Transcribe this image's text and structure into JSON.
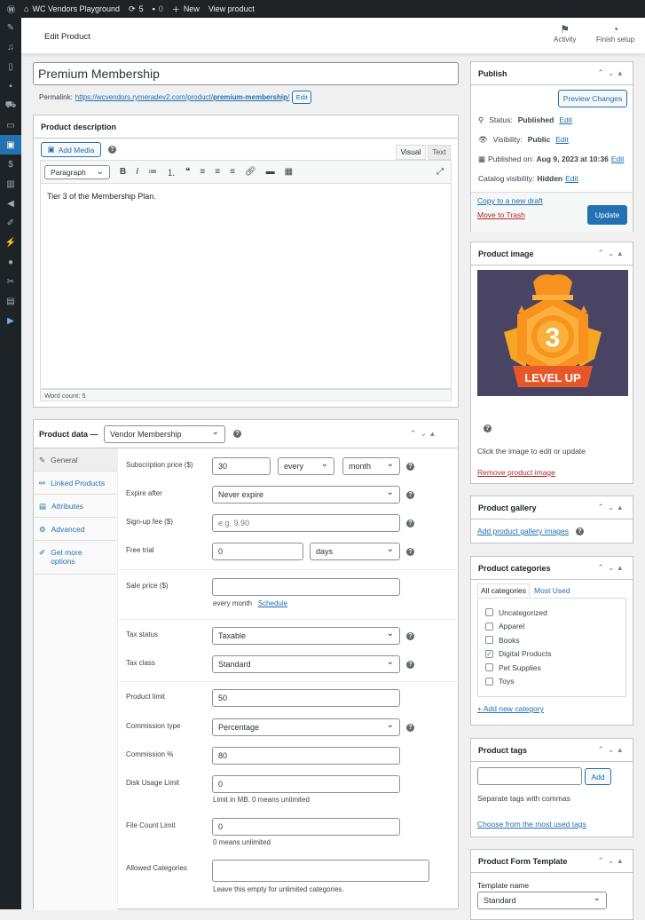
{
  "adminbar": {
    "site": "WC Vendors Playground",
    "updates": "5",
    "comments": "0",
    "new": "New",
    "view": "View product"
  },
  "header": {
    "title": "Edit Product",
    "activity": "Activity",
    "finish_setup": "Finish setup"
  },
  "sidebar": {
    "icons": [
      "pin-icon",
      "media-icon",
      "pages-icon",
      "comments-icon",
      "cart-icon",
      "woo-icon",
      "products-icon",
      "payments-icon",
      "analytics-icon",
      "marketing-icon",
      "appearance-icon",
      "plugins-icon",
      "users-icon",
      "tools-icon",
      "settings-icon",
      "play-icon"
    ]
  },
  "title_value": "Premium Membership",
  "permalink": {
    "label": "Permalink:",
    "url_base": "https://wcvendors.rymeradev2.com/product/",
    "slug": "premium-membership",
    "suffix": "/",
    "edit": "Edit"
  },
  "description": {
    "heading": "Product description",
    "add_media": "Add Media",
    "tab_visual": "Visual",
    "tab_text": "Text",
    "format": "Paragraph",
    "content": "Tier 3 of the Membership Plan.",
    "word_count": "Word count: 5"
  },
  "product_data": {
    "heading": "Product data —",
    "type": "Vendor Membership",
    "tabs": [
      {
        "label": "General",
        "icon": "wrench-icon"
      },
      {
        "label": "Linked Products",
        "icon": "link-icon"
      },
      {
        "label": "Attributes",
        "icon": "table-icon"
      },
      {
        "label": "Advanced",
        "icon": "gear-icon"
      },
      {
        "label": "Get more options",
        "icon": "plugin-icon"
      }
    ],
    "fields": {
      "sub_price_label": "Subscription price ($)",
      "sub_price": "30",
      "every": "every",
      "period": "month",
      "expire_label": "Expire after",
      "expire": "Never expire",
      "signup_label": "Sign-up fee ($)",
      "signup_placeholder": "e.g. 9.90",
      "trial_label": "Free trial",
      "trial": "0",
      "trial_unit": "days",
      "sale_label": "Sale price ($)",
      "sale": "",
      "sale_hint": "every month",
      "schedule": "Schedule",
      "tax_status_label": "Tax status",
      "tax_status": "Taxable",
      "tax_class_label": "Tax class",
      "tax_class": "Standard",
      "limit_label": "Product limit",
      "limit": "50",
      "comm_type_label": "Commission type",
      "comm_type": "Percentage",
      "comm_pct_label": "Commission %",
      "comm_pct": "80",
      "disk_label": "Disk Usage Limit",
      "disk": "0",
      "disk_hint": "Limit in MB. 0 means unlimited",
      "file_label": "File Count Limit",
      "file": "0",
      "file_hint": "0 means unlimited",
      "allowed_label": "Allowed Categories",
      "allowed": "",
      "allowed_hint": "Leave this empty for unlimited categories."
    }
  },
  "publish": {
    "heading": "Publish",
    "preview": "Preview Changes",
    "status_label": "Status:",
    "status": "Published",
    "visibility_label": "Visibility:",
    "visibility": "Public",
    "published_label": "Published on:",
    "published": "Aug 9, 2023 at 10:36",
    "catalog_label": "Catalog visibility:",
    "catalog": "Hidden",
    "edit": "Edit",
    "copy": "Copy to a new draft",
    "trash": "Move to Trash",
    "update": "Update"
  },
  "image": {
    "heading": "Product image",
    "badge_number": "3",
    "badge_text": "LEVEL UP",
    "hint": "Click the image to edit or update",
    "remove": "Remove product image"
  },
  "gallery": {
    "heading": "Product gallery",
    "add": "Add product gallery images"
  },
  "categories": {
    "heading": "Product categories",
    "tab_all": "All categories",
    "tab_used": "Most Used",
    "items": [
      {
        "label": "Uncategorized",
        "checked": false
      },
      {
        "label": "Apparel",
        "checked": false
      },
      {
        "label": "Books",
        "checked": false
      },
      {
        "label": "Digital Products",
        "checked": true
      },
      {
        "label": "Pet Supplies",
        "checked": false
      },
      {
        "label": "Toys",
        "checked": false
      }
    ],
    "add": "+ Add new category"
  },
  "tags": {
    "heading": "Product tags",
    "add": "Add",
    "hint": "Separate tags with commas",
    "choose": "Choose from the most used tags"
  },
  "template": {
    "heading": "Product Form Template",
    "label": "Template name",
    "value": "Standard"
  },
  "colors": {
    "primary": "#2271b1",
    "danger": "#b32d2e",
    "adminbar": "#1d2327"
  }
}
